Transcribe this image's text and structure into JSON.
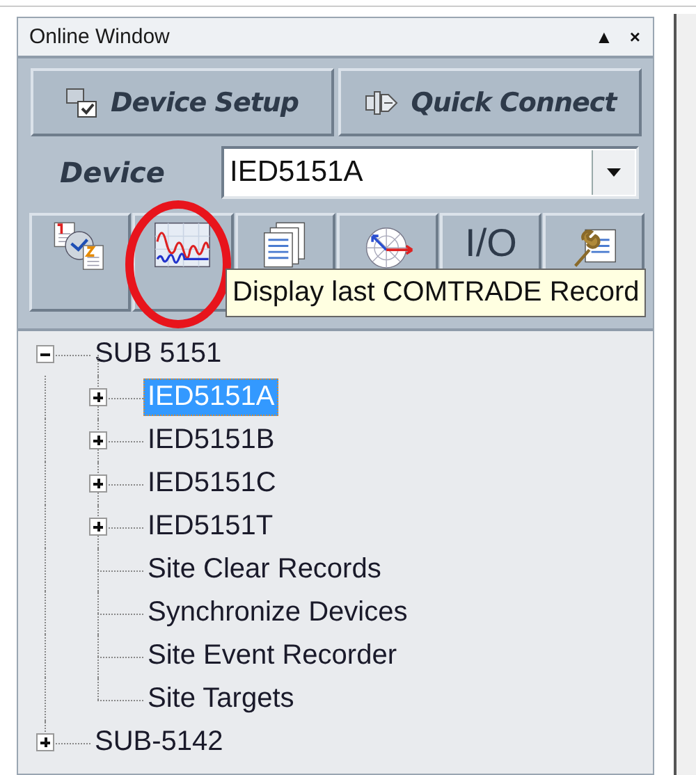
{
  "window": {
    "title": "Online Window",
    "controls": [
      "▲",
      "×"
    ]
  },
  "header_buttons": [
    {
      "label": "Device Setup"
    },
    {
      "label": "Quick Connect"
    }
  ],
  "device": {
    "label": "Device",
    "value": "IED5151A"
  },
  "toolbar": [
    {
      "kind": "icon"
    },
    {
      "kind": "icon"
    },
    {
      "kind": "icon"
    },
    {
      "kind": "icon"
    },
    {
      "kind": "text",
      "label": "I/O"
    },
    {
      "kind": "icon"
    }
  ],
  "tooltip": {
    "text": "Display last COMTRADE Record"
  },
  "tree": [
    {
      "label": "SUB 5151",
      "expanded": true,
      "selected": false,
      "children": [
        {
          "label": "IED5151A",
          "expanded": false,
          "selected": true
        },
        {
          "label": "IED5151B",
          "expanded": false,
          "selected": false
        },
        {
          "label": "IED5151C",
          "expanded": false,
          "selected": false
        },
        {
          "label": "IED5151T",
          "expanded": false,
          "selected": false
        },
        {
          "label": "Site Clear Records",
          "selected": false
        },
        {
          "label": "Synchronize Devices",
          "selected": false
        },
        {
          "label": "Site Event Recorder",
          "selected": false
        },
        {
          "label": "Site Targets",
          "selected": false
        }
      ]
    },
    {
      "label": "SUB-5142",
      "expanded": false,
      "selected": false
    }
  ]
}
